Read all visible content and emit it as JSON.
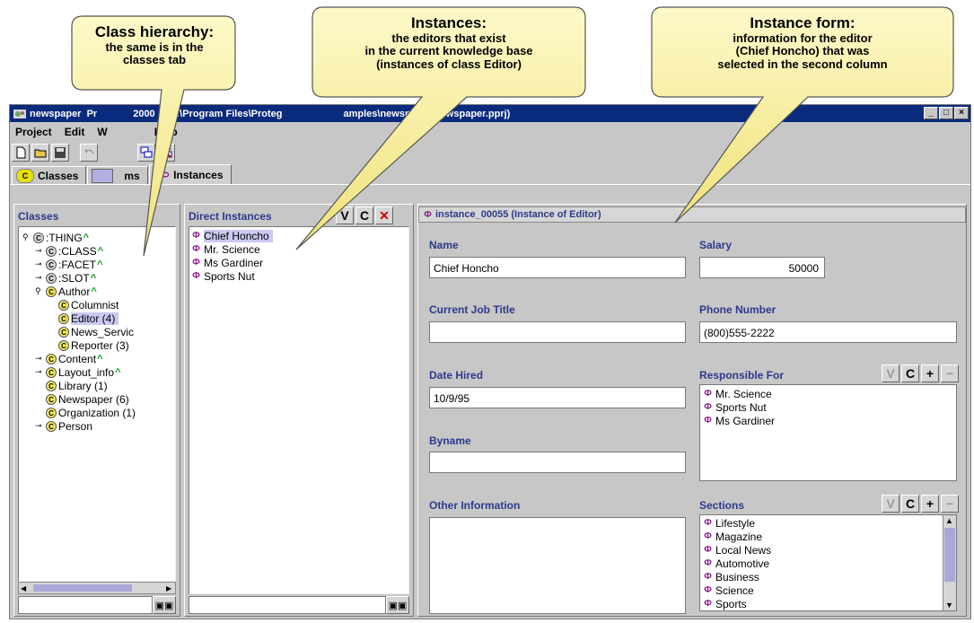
{
  "callouts": {
    "class_hierarchy": {
      "title": "Class hierarchy:",
      "line1": "the same is in the",
      "line2": "classes tab"
    },
    "instances": {
      "title": "Instances:",
      "line1": "the editors that exist",
      "line2": "in the current knowledge base",
      "line3": "(instances of class Editor)"
    },
    "instance_form": {
      "title": "Instance form:",
      "line1": "information for the editor",
      "line2": "(Chief Honcho) that was",
      "line3": "selected in the second column"
    }
  },
  "window": {
    "title": "newspaper  Protégé-2000    (C:\\Program Files\\Protege-2000\\examples\\newspaper\\newspaper.pprj)",
    "title_visible_a": "newspaper  Pr",
    "title_visible_b": "2000    (C:\\Program Files\\Proteg",
    "title_visible_c": "amples\\newspaper\\newspaper.pprj)",
    "minimize": "_",
    "maximize": "□",
    "close": "×"
  },
  "menu": {
    "project": "Project",
    "edit": "Edit",
    "window": "W",
    "help": "Help"
  },
  "tabs": {
    "classes": "Classes",
    "forms": "ms",
    "instances": "Instances"
  },
  "classes_panel": {
    "header": "Classes",
    "tree": [
      {
        "label": ":THING",
        "icon": "gray",
        "depth": 0,
        "expander": "⚲",
        "up": true
      },
      {
        "label": ":CLASS",
        "icon": "gray",
        "depth": 1,
        "expander": "⊸",
        "up": true
      },
      {
        "label": ":FACET",
        "icon": "gray",
        "depth": 1,
        "expander": "⊸",
        "up": true
      },
      {
        "label": ":SLOT",
        "icon": "gray",
        "depth": 1,
        "expander": "⊸",
        "up": true
      },
      {
        "label": "Author",
        "icon": "yellow",
        "depth": 1,
        "expander": "⚲",
        "up": true
      },
      {
        "label": "Columnist",
        "icon": "yellow",
        "depth": 2,
        "expander": "",
        "up": false
      },
      {
        "label": "Editor  (4)",
        "icon": "yellow",
        "depth": 2,
        "expander": "",
        "up": false,
        "selected": true
      },
      {
        "label": "News_Servic",
        "icon": "yellow",
        "depth": 2,
        "expander": "",
        "up": false
      },
      {
        "label": "Reporter  (3)",
        "icon": "yellow",
        "depth": 2,
        "expander": "",
        "up": false
      },
      {
        "label": "Content",
        "icon": "yellow",
        "depth": 1,
        "expander": "⊸",
        "up": true
      },
      {
        "label": "Layout_info",
        "icon": "yellow",
        "depth": 1,
        "expander": "⊸",
        "up": true
      },
      {
        "label": "Library  (1)",
        "icon": "yellow",
        "depth": 1,
        "expander": "",
        "up": false
      },
      {
        "label": "Newspaper  (6)",
        "icon": "yellow",
        "depth": 1,
        "expander": "",
        "up": false
      },
      {
        "label": "Organization  (1)",
        "icon": "yellow",
        "depth": 1,
        "expander": "",
        "up": false
      },
      {
        "label": "Person",
        "icon": "yellow",
        "depth": 1,
        "expander": "⊸",
        "up": false
      }
    ]
  },
  "instances_panel": {
    "header": "Direct Instances",
    "buttons": {
      "v": "V",
      "c": "C",
      "x": "✕"
    },
    "items": [
      "Chief Honcho",
      "Mr. Science",
      "Ms Gardiner",
      "Sports Nut"
    ],
    "selected_index": 0
  },
  "form": {
    "header": "instance_00055   (Instance of Editor)",
    "name_label": "Name",
    "name_value": "Chief Honcho",
    "salary_label": "Salary",
    "salary_value": "50000",
    "job_label": "Current Job Title",
    "job_value": "",
    "phone_label": "Phone Number",
    "phone_value": "(800)555-2222",
    "hired_label": "Date Hired",
    "hired_value": "10/9/95",
    "responsible_label": "Responsible For",
    "responsible_items": [
      "Mr. Science",
      "Sports Nut",
      "Ms Gardiner"
    ],
    "byname_label": "Byname",
    "byname_value": "",
    "other_label": "Other Information",
    "sections_label": "Sections",
    "sections_items": [
      "Lifestyle",
      "Magazine",
      "Local News",
      "Automotive",
      "Business",
      "Science",
      "Sports"
    ],
    "btn_v": "V",
    "btn_c": "C",
    "btn_plus": "+",
    "btn_minus": "−"
  },
  "colors": {
    "title_bar": "#0a2a7e",
    "label_blue": "#2b3a8c",
    "callout_fill": "#fbf4a6",
    "selection": "#c9c9f3"
  }
}
